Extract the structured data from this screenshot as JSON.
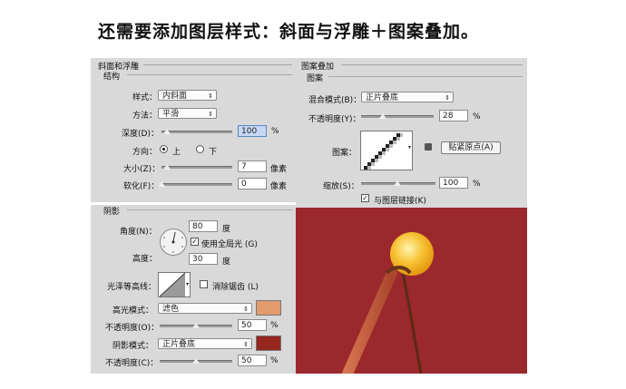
{
  "caption": "还需要添加图层样式：斜面与浮雕＋图案叠加。",
  "bevel": {
    "section_title": "斜面和浮雕",
    "group_title": "结构",
    "style_label": "样式：",
    "style_value": "内斜面",
    "technique_label": "方法：",
    "technique_value": "平滑",
    "depth_label": "深度(D)：",
    "depth_value": "100",
    "depth_unit": "%",
    "direction_label": "方向：",
    "direction_up": "上",
    "direction_down": "下",
    "size_label": "大小(Z)：",
    "size_value": "7",
    "size_unit": "像素",
    "soften_label": "软化(F)：",
    "soften_value": "0",
    "soften_unit": "像素"
  },
  "shading": {
    "group_title": "阴影",
    "angle_label": "角度(N)：",
    "angle_value": "80",
    "angle_unit": "度",
    "global_light_label": "使用全局光 (G)",
    "altitude_label": "高度：",
    "altitude_value": "30",
    "altitude_unit": "度",
    "gloss_label": "光泽等高线：",
    "antialias_label": "消除锯齿 (L)",
    "highlight_mode_label": "高光模式：",
    "highlight_mode_value": "滤色",
    "highlight_color": "#e39a6c",
    "highlight_opacity_label": "不透明度(O)：",
    "highlight_opacity_value": "50",
    "highlight_opacity_unit": "%",
    "shadow_mode_label": "阴影模式：",
    "shadow_mode_value": "正片叠底",
    "shadow_color": "#96271e",
    "shadow_opacity_label": "不透明度(C)：",
    "shadow_opacity_value": "50",
    "shadow_opacity_unit": "%"
  },
  "pattern": {
    "section_title": "图案叠加",
    "group_title": "图案",
    "blend_label": "混合模式(B)：",
    "blend_value": "正片叠底",
    "opacity_label": "不透明度(Y)：",
    "opacity_value": "28",
    "opacity_unit": "%",
    "pattern_label": "图案：",
    "snap_button": "贴紧原点(A)",
    "scale_label": "缩放(S)：",
    "scale_value": "100",
    "scale_unit": "%",
    "link_label": "与图层链接(K)"
  },
  "colors": {
    "panel_bg": "#d9d9d9",
    "canvas_bg": "#9b282c",
    "stick": "#c9664a",
    "bulb": "#f7c234"
  }
}
